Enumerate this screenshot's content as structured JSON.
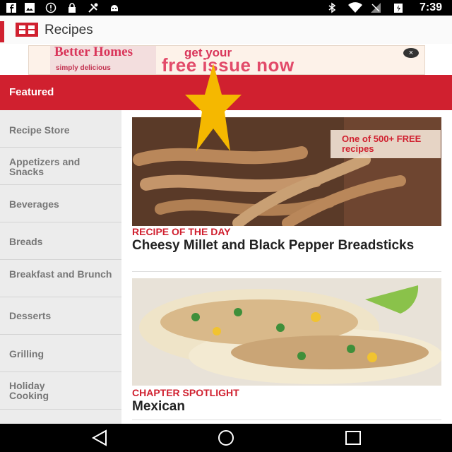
{
  "status": {
    "time": "7:39"
  },
  "appbar": {
    "title": "Recipes",
    "icon": "app-logo-icon"
  },
  "ad": {
    "mag_title": "Better Homes",
    "mag_sub": "simply delicious",
    "head1": "get your",
    "head2": "free issue now",
    "close": "×"
  },
  "featured": "Featured",
  "categories": [
    "Recipe Store",
    "Appetizers and Snacks",
    "Beverages",
    "Breads",
    "Breakfast and Brunch",
    "Desserts",
    "Grilling",
    "Holiday Cooking"
  ],
  "cards": [
    {
      "badge": "One of 500+ FREE recipes",
      "label": "RECIPE OF THE DAY",
      "title": "Cheesy Millet and Black Pepper Breadsticks"
    },
    {
      "label": "CHAPTER SPOTLIGHT",
      "title": "Mexican"
    }
  ],
  "colors": {
    "accent": "#d0202f",
    "star": "#f5b800"
  }
}
